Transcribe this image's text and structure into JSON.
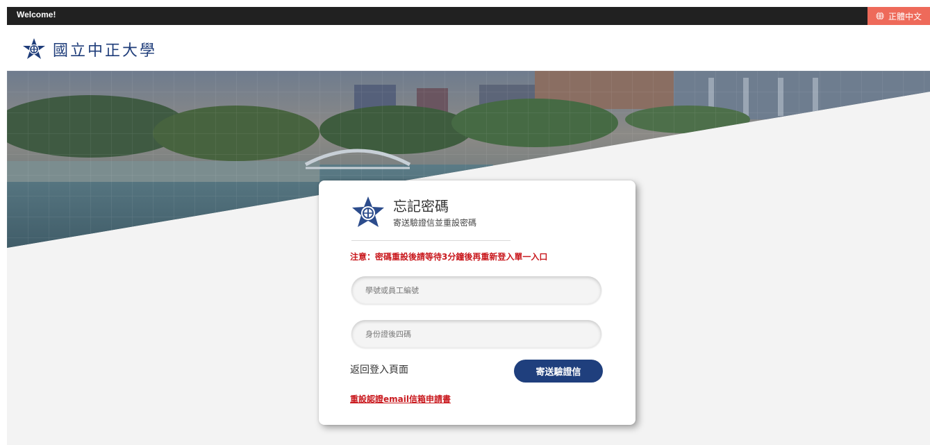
{
  "topbar": {
    "welcome": "Welcome!",
    "language": "正體中文"
  },
  "brand": {
    "name": "國立中正大學"
  },
  "card": {
    "title": "忘記密碼",
    "subtitle": "寄送驗證信並重設密碼",
    "notice": "注意：密碼重設後請等待3分鐘後再重新登入單一入口",
    "id_placeholder": "學號或員工編號",
    "id_value": "",
    "idcard_placeholder": "身份證後四碼",
    "idcard_value": "",
    "back_label": "返回登入頁面",
    "send_label": "寄送驗證信",
    "reset_email_label": "重設認證email信箱申請書"
  },
  "colors": {
    "primary": "#1f3f7d",
    "alert": "#c9191e",
    "lang_bg": "#ee6a5a",
    "topbar_bg": "#212121"
  }
}
